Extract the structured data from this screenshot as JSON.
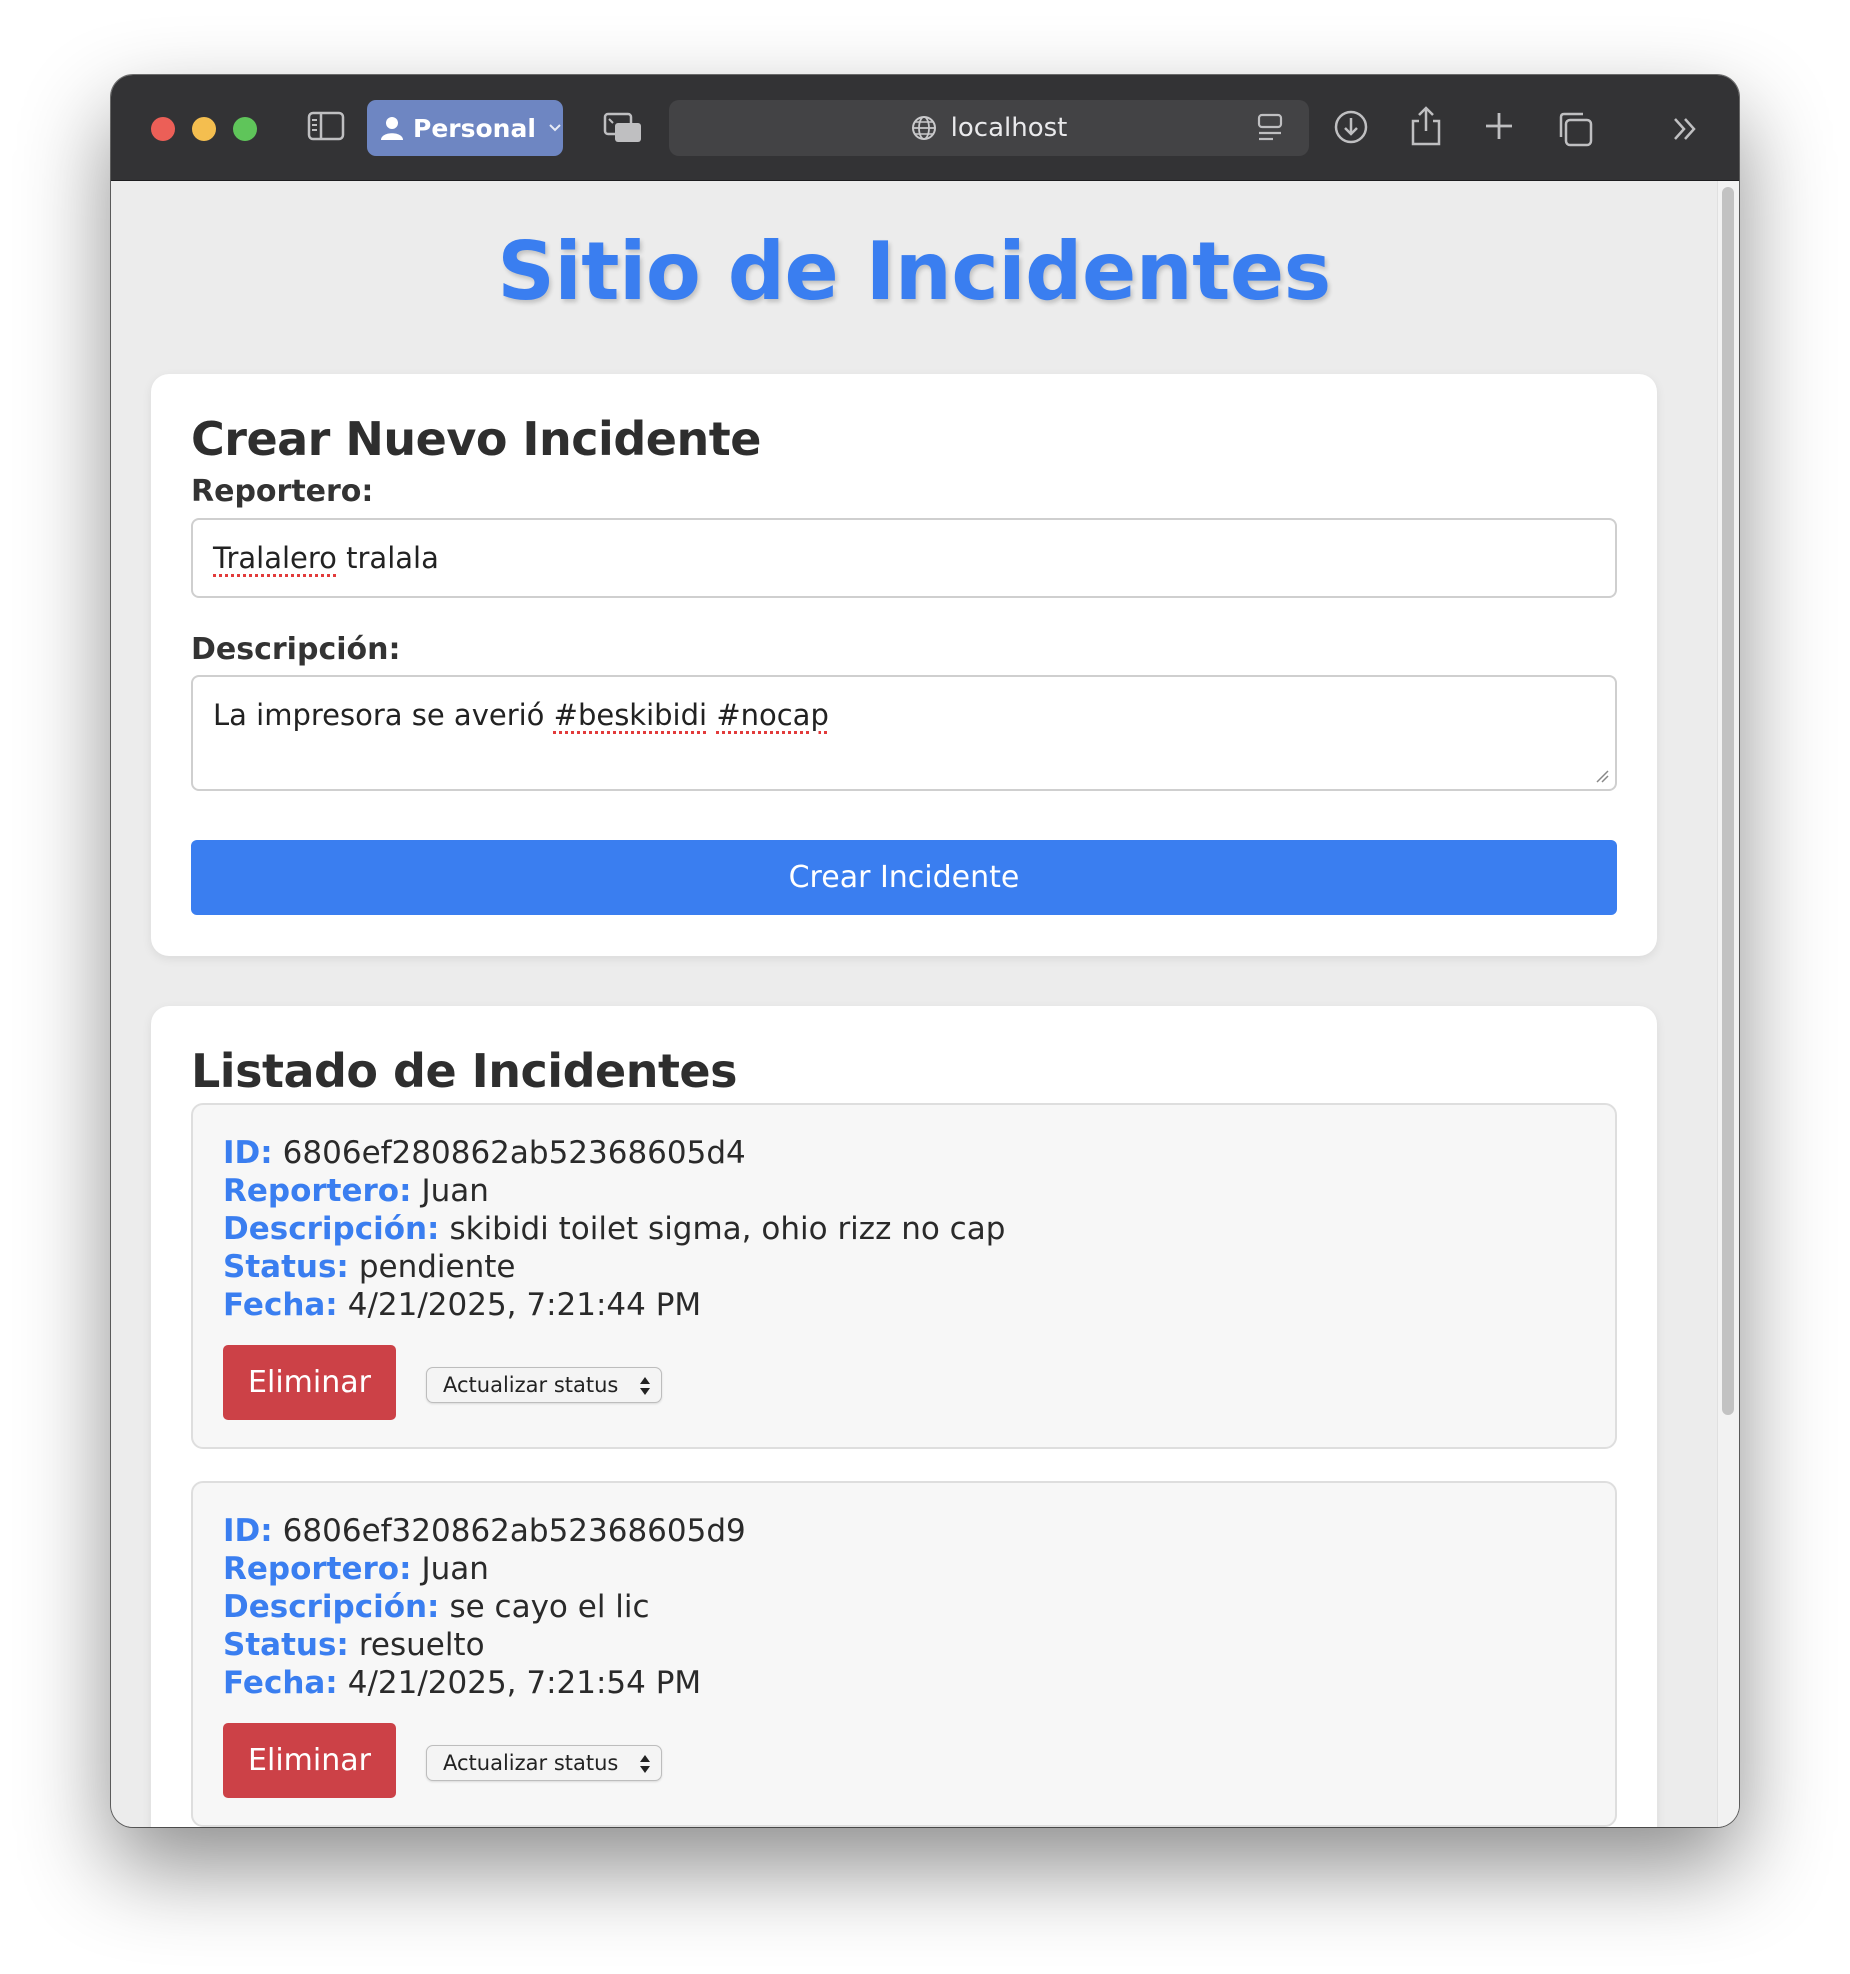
{
  "browser": {
    "profile_label": "Personal",
    "address": "localhost"
  },
  "page": {
    "title": "Sitio de Incidentes"
  },
  "form": {
    "heading": "Crear Nuevo Incidente",
    "reporter_label": "Reportero:",
    "reporter_value_word1": "Tralalero",
    "reporter_value_rest": " tralala",
    "description_label": "Descripción:",
    "description_value_start": "La impresora se averió ",
    "description_value_tag1": "#beskibidi",
    "description_value_space": " ",
    "description_value_tag2": "#nocap",
    "submit_label": "Crear Incidente"
  },
  "list": {
    "heading": "Listado de Incidentes",
    "field_labels": {
      "id": "ID:",
      "reporter": "Reportero:",
      "description": "Descripción:",
      "status": "Status:",
      "date": "Fecha:"
    },
    "delete_label": "Eliminar",
    "status_select_label": "Actualizar status",
    "incidents": [
      {
        "id": "6806ef280862ab52368605d4",
        "reporter": "Juan",
        "description": "skibidi toilet sigma, ohio rizz no cap",
        "status": "pendiente",
        "date": "4/21/2025, 7:21:44 PM"
      },
      {
        "id": "6806ef320862ab52368605d9",
        "reporter": "Juan",
        "description": "se cayo el lic",
        "status": "resuelto",
        "date": "4/21/2025, 7:21:54 PM"
      }
    ]
  },
  "colors": {
    "accent": "#3a7ef0",
    "danger": "#cc4147",
    "toolbar": "#333335"
  }
}
